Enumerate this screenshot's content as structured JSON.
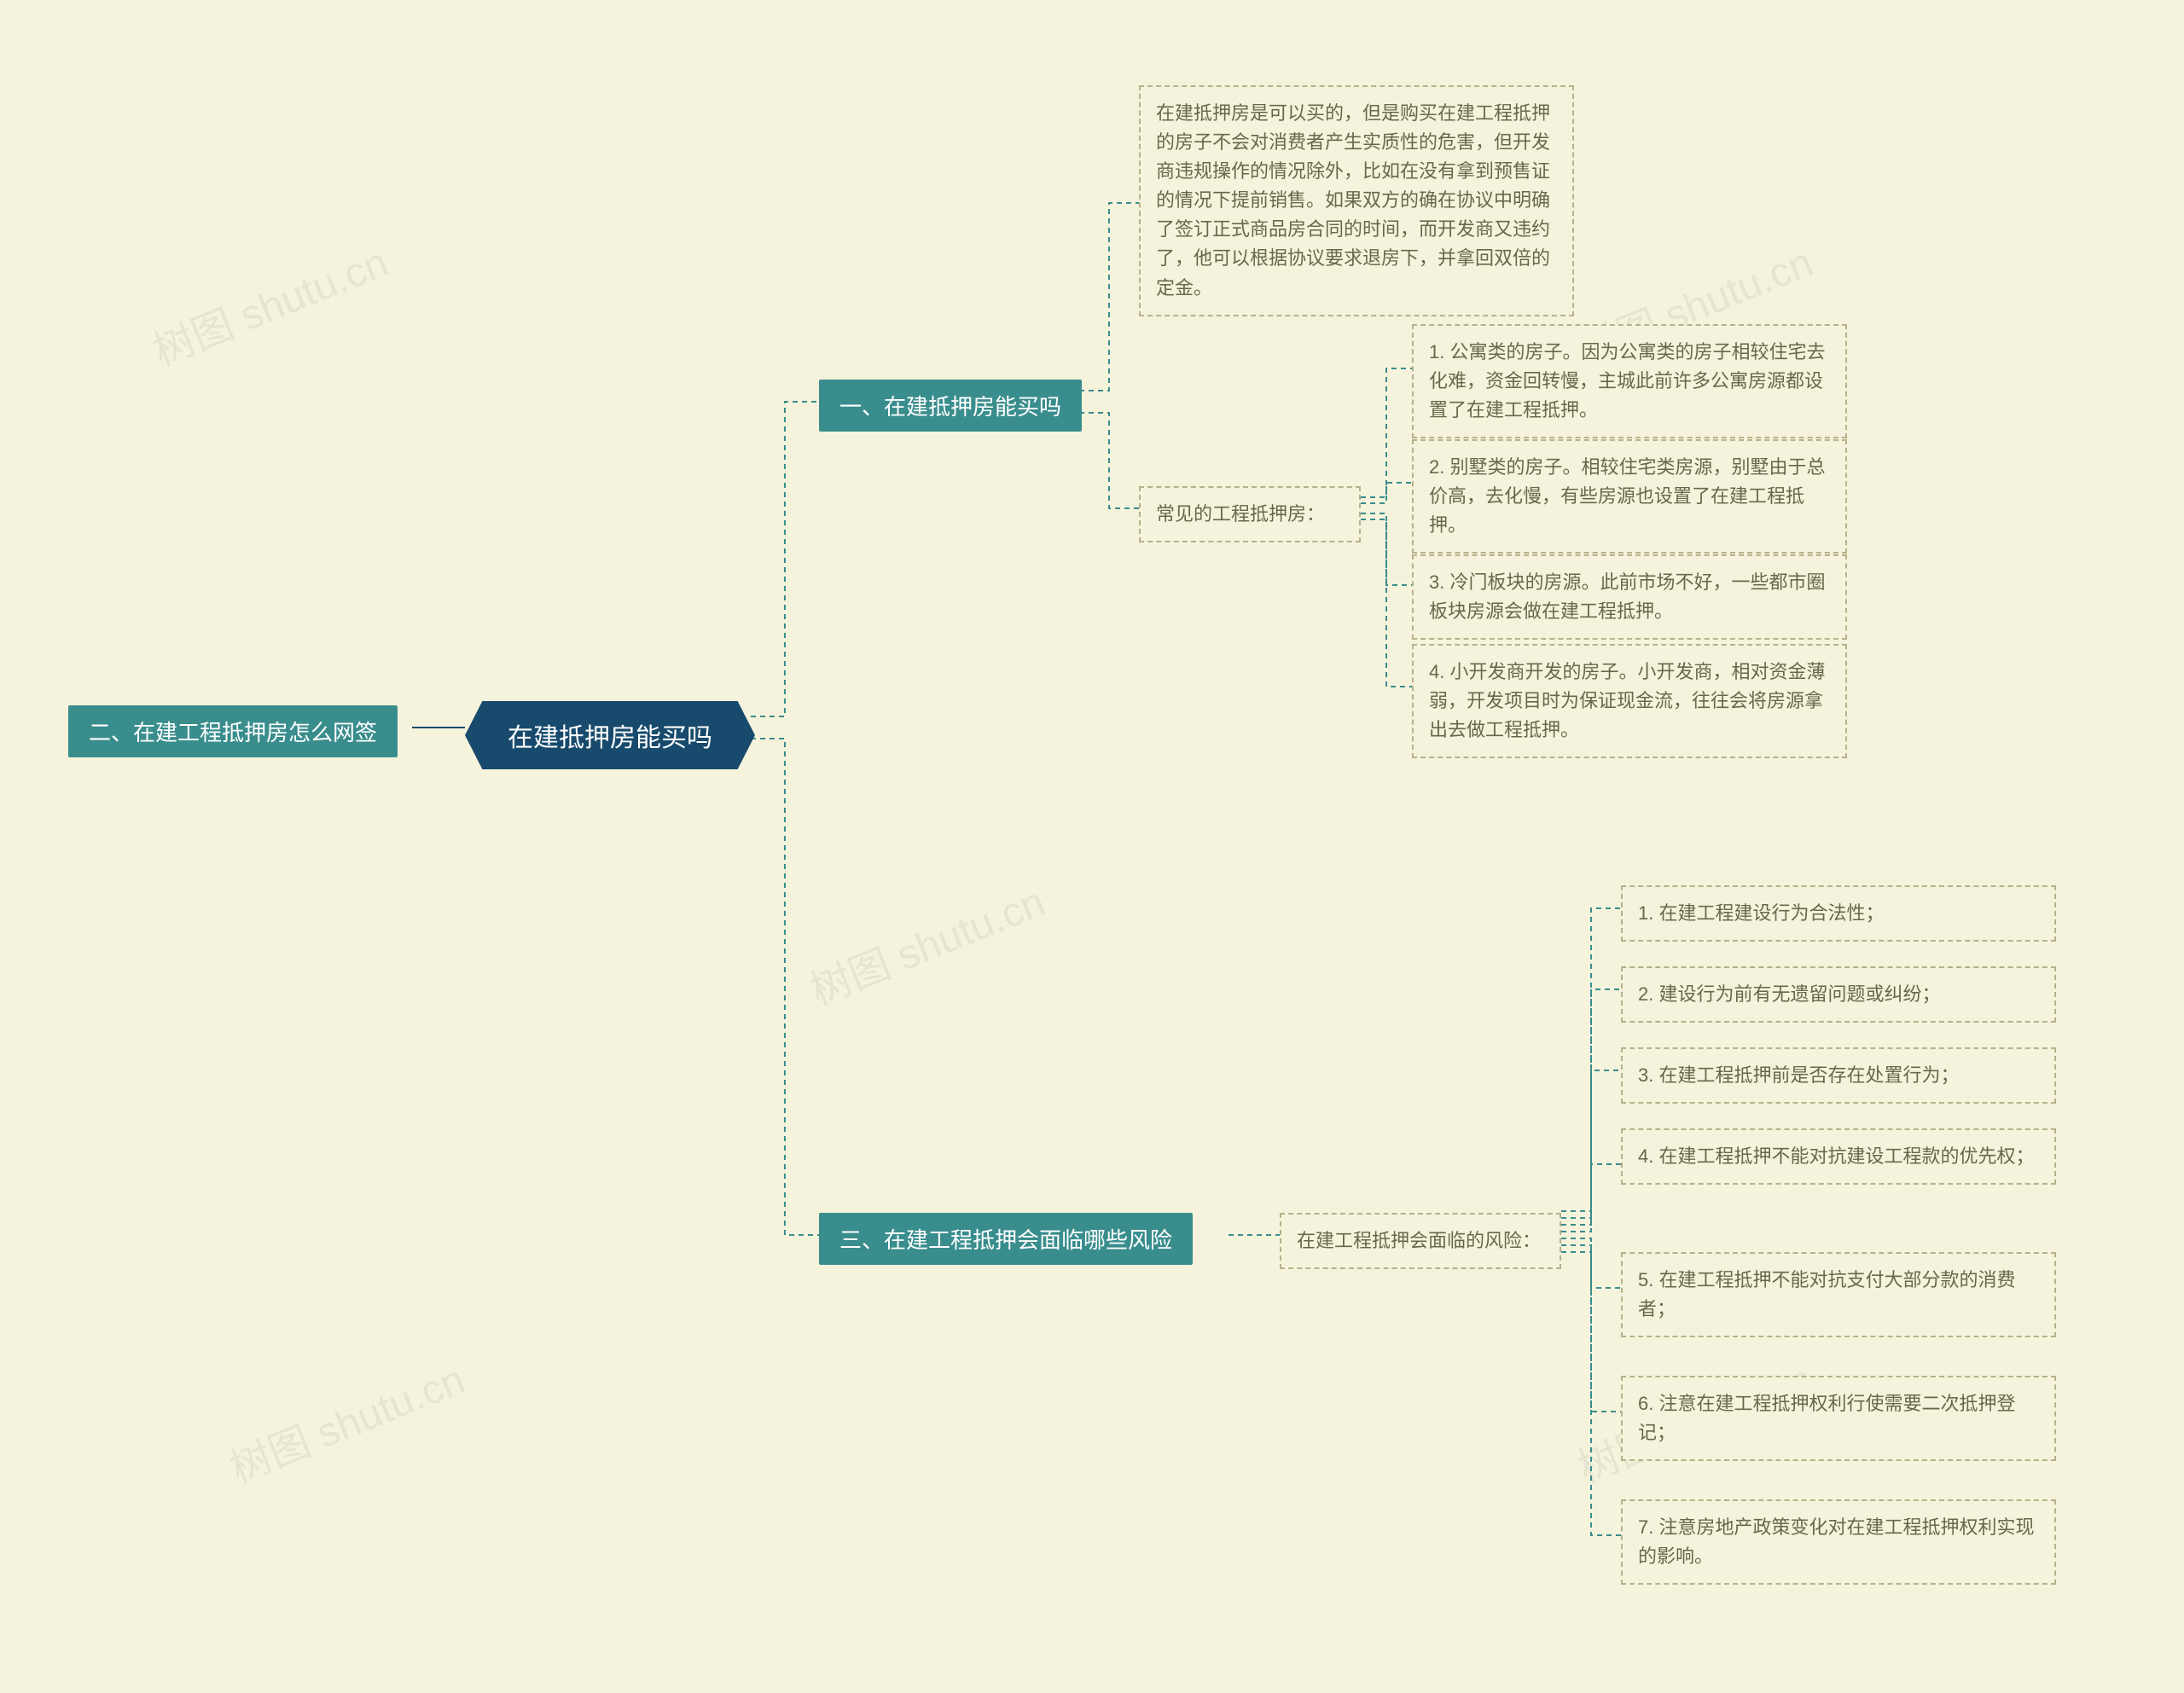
{
  "watermark": "树图 shutu.cn",
  "root": {
    "title": "在建抵押房能买吗"
  },
  "left": {
    "section2": {
      "title": "二、在建工程抵押房怎么网签"
    }
  },
  "right": {
    "section1": {
      "title": "一、在建抵押房能买吗",
      "desc": "在建抵押房是可以买的，但是购买在建工程抵押的房子不会对消费者产生实质性的危害，但开发商违规操作的情况除外，比如在没有拿到预售证的情况下提前销售。如果双方的确在协议中明确了签订正式商品房合同的时间，而开发商又违约了，他可以根据协议要求退房下，并拿回双倍的定金。",
      "common_label": "常见的工程抵押房：",
      "items": {
        "i1": "1. 公寓类的房子。因为公寓类的房子相较住宅去化难，资金回转慢，主城此前许多公寓房源都设置了在建工程抵押。",
        "i2": "2. 别墅类的房子。相较住宅类房源，别墅由于总价高，去化慢，有些房源也设置了在建工程抵押。",
        "i3": "3. 冷门板块的房源。此前市场不好，一些都市圈板块房源会做在建工程抵押。",
        "i4": "4. 小开发商开发的房子。小开发商，相对资金薄弱，开发项目时为保证现金流，往往会将房源拿出去做工程抵押。"
      }
    },
    "section3": {
      "title": "三、在建工程抵押会面临哪些风险",
      "risk_label": "在建工程抵押会面临的风险：",
      "items": {
        "r1": "1. 在建工程建设行为合法性；",
        "r2": "2. 建设行为前有无遗留问题或纠纷；",
        "r3": "3. 在建工程抵押前是否存在处置行为；",
        "r4": "4. 在建工程抵押不能对抗建设工程款的优先权；",
        "r5": "5. 在建工程抵押不能对抗支付大部分款的消费者；",
        "r6": "6. 注意在建工程抵押权利行使需要二次抵押登记；",
        "r7": "7. 注意房地产政策变化对在建工程抵押权利实现的影响。"
      }
    }
  }
}
